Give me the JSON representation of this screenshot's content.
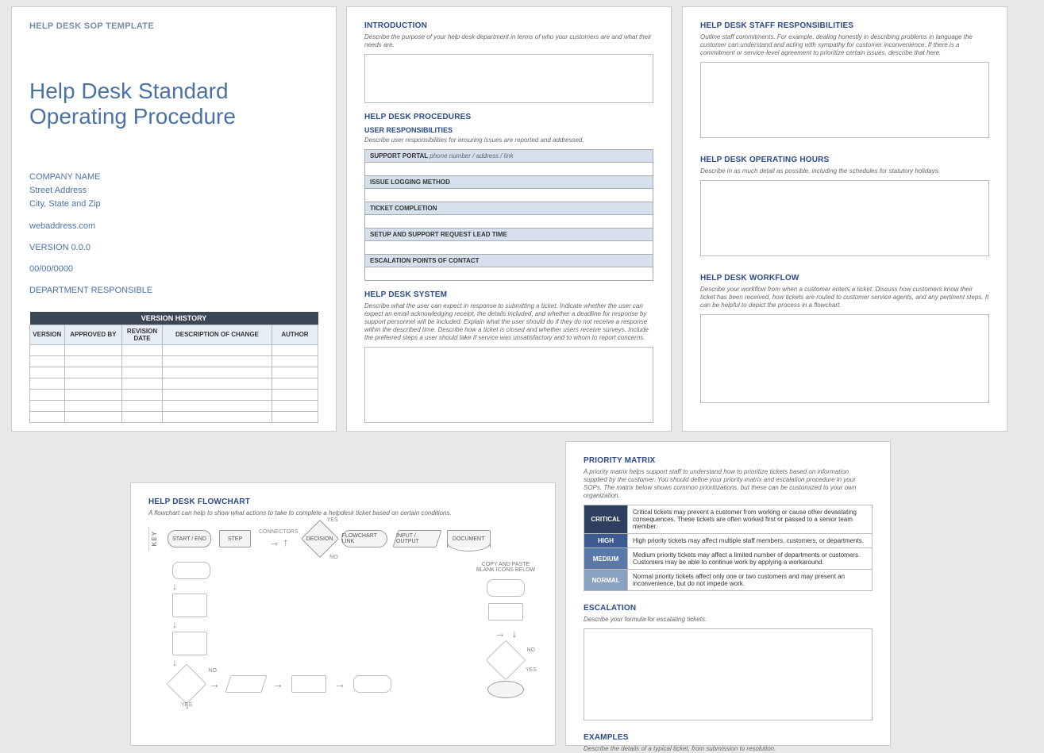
{
  "page1": {
    "tag": "HELP DESK SOP TEMPLATE",
    "title": "Help Desk Standard Operating Procedure",
    "company": "COMPANY NAME",
    "street": "Street Address",
    "csz": "City, State and Zip",
    "web": "webaddress.com",
    "version": "VERSION 0.0.0",
    "date": "00/00/0000",
    "dept": "DEPARTMENT RESPONSIBLE",
    "vh_title": "VERSION HISTORY",
    "vh_cols": [
      "VERSION",
      "APPROVED BY",
      "REVISION DATE",
      "DESCRIPTION OF CHANGE",
      "AUTHOR"
    ]
  },
  "page2": {
    "intro_head": "INTRODUCTION",
    "intro_desc": "Describe the purpose of your help desk department in terms of who your customers are and what their needs are.",
    "proc_head": "HELP DESK PROCEDURES",
    "user_head": "USER RESPONSIBILITIES",
    "user_desc": "Describe user responsibilities for ensuring issues are reported and addressed.",
    "rows": [
      {
        "label": "SUPPORT PORTAL",
        "hint": "phone number / address / link"
      },
      {
        "label": "ISSUE LOGGING METHOD",
        "hint": ""
      },
      {
        "label": "TICKET COMPLETION",
        "hint": ""
      },
      {
        "label": "SETUP AND SUPPORT REQUEST LEAD TIME",
        "hint": ""
      },
      {
        "label": "ESCALATION POINTS OF CONTACT",
        "hint": ""
      }
    ],
    "sys_head": "HELP DESK SYSTEM",
    "sys_desc": "Describe what the user can expect in response to submitting a ticket. Indicate whether the user can expect an email acknowledging receipt, the details included, and whether a deadline for response by support personnel will be included. Explain what the user should do if they do not receive a response within the described time. Describe how a ticket is closed and whether users receive surveys. Include the preferred steps a user should take if service was unsatisfactory and to whom to report concerns."
  },
  "page3": {
    "staff_head": "HELP DESK STAFF RESPONSIBILITIES",
    "staff_desc": "Outline staff commitments. For example, dealing honestly in describing problems in language the customer can understand and acting with sympathy for customer inconvenience. If there is a commitment or service-level agreement to prioritize certain issues, describe that here.",
    "hours_head": "HELP DESK OPERATING HOURS",
    "hours_desc": "Describe in as much detail as possible, including the schedules for statutory holidays.",
    "wf_head": "HELP DESK WORKFLOW",
    "wf_desc": "Describe your workflow from when a customer enters a ticket. Discuss how customers know their ticket has been received, how tickets are routed to customer service agents, and any pertinent steps. It can be helpful to depict the process in a flowchart."
  },
  "page4": {
    "head": "HELP DESK FLOWCHART",
    "desc": "A flowchart can help to show what actions to take to complete a helpdesk ticket based on certain conditions.",
    "key": "KEY",
    "k_start": "START / END",
    "k_step": "STEP",
    "k_conn": "CONNECTORS",
    "k_dec": "DECISION",
    "k_yes": "YES",
    "k_no": "NO",
    "k_link": "FLOWCHART LINK",
    "k_io": "INPUT / OUTPUT",
    "k_doc": "DOCUMENT",
    "copy": "COPY AND PASTE BLANK ICONS BELOW"
  },
  "page5": {
    "prio_head": "PRIORITY MATRIX",
    "prio_desc": "A priority matrix helps support staff to understand how to prioritize tickets based on information supplied by the customer. You should define your priority matrix and escalation procedure in your SOPs. The matrix below shows common prioritizations, but these can be customized to your own organization.",
    "rows": [
      {
        "label": "CRITICAL",
        "cls": "c-crit",
        "text": "Critical tickets may prevent a customer from working or cause other devastating consequences. These tickets are often worked first or passed to a senior team member."
      },
      {
        "label": "HIGH",
        "cls": "c-high",
        "text": "High priority tickets may affect multiple staff members, customers, or departments."
      },
      {
        "label": "MEDIUM",
        "cls": "c-med",
        "text": "Medium priority tickets may affect a limited number of departments or customers. Customers may be able to continue work by applying a workaround."
      },
      {
        "label": "NORMAL",
        "cls": "c-norm",
        "text": "Normal priority tickets affect only one or two customers and may present an inconvenience, but do not impede work."
      }
    ],
    "esc_head": "ESCALATION",
    "esc_desc": "Describe your formula for escalating tickets.",
    "ex_head": "EXAMPLES",
    "ex_desc": "Describe the details of a typical ticket, from submission to resolution."
  }
}
